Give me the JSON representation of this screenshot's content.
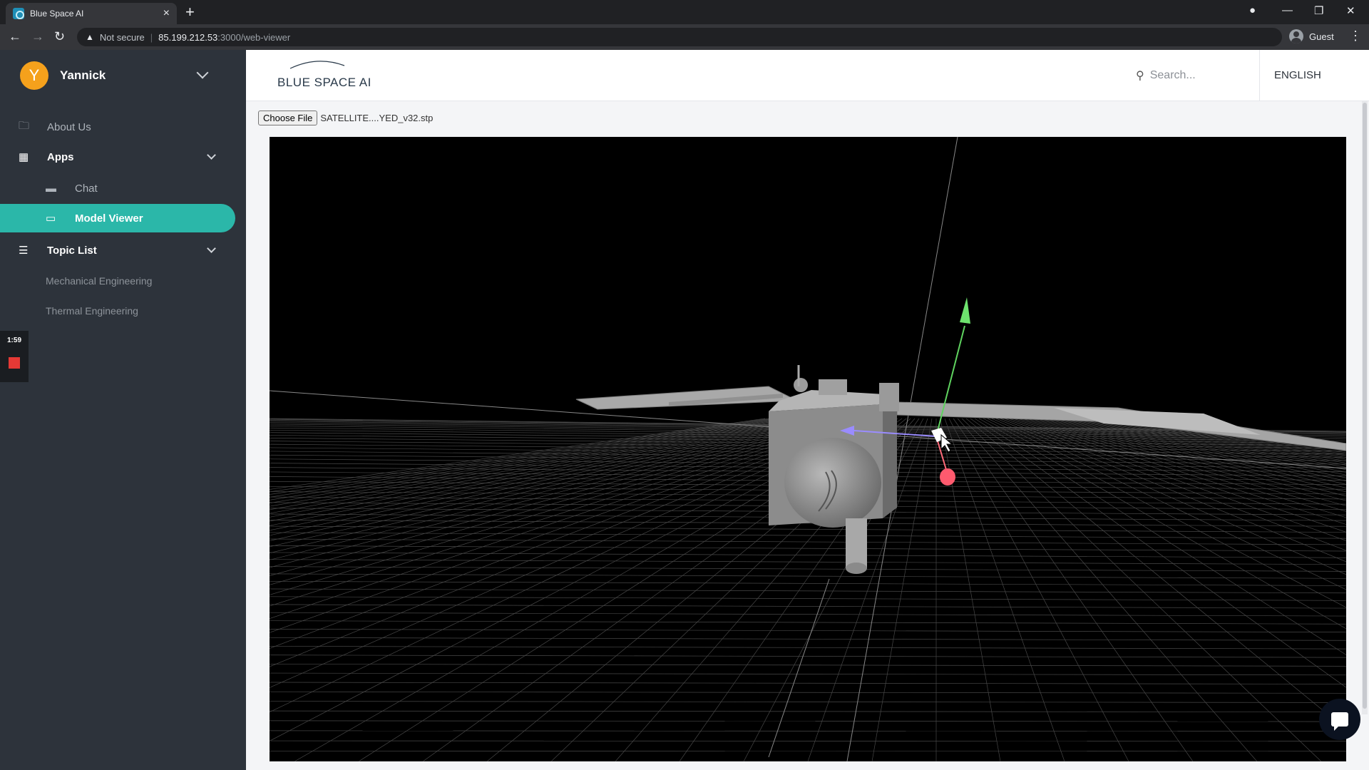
{
  "browser": {
    "tab_title": "Blue Space AI",
    "tab_close": "×",
    "new_tab": "+",
    "security_label": "Not secure",
    "url_host": "85.199.212.53",
    "url_path": ":3000/web-viewer",
    "profile_name": "Guest"
  },
  "sidebar": {
    "user_initial": "Y",
    "user_name": "Yannick",
    "items": [
      {
        "label": "About Us",
        "icon": "briefcase-icon"
      },
      {
        "label": "Apps",
        "icon": "grid-icon"
      },
      {
        "label": "Chat",
        "icon": "chat-icon"
      },
      {
        "label": "Model Viewer",
        "icon": "monitor-icon",
        "active": true
      },
      {
        "label": "Topic List",
        "icon": "list-icon"
      },
      {
        "label": "Mechanical Engineering"
      },
      {
        "label": "Thermal Engineering"
      }
    ],
    "recorder_time": "1:59"
  },
  "header": {
    "logo_text": "BLUE SPACE AI",
    "search_placeholder": "Search...",
    "language": "ENGLISH"
  },
  "viewer": {
    "choose_file_label": "Choose File",
    "file_name": "SATELLITE....YED_v32.stp"
  },
  "colors": {
    "sidebar_bg": "#2d333b",
    "accent": "#2bb7a9",
    "avatar": "#f5a11c",
    "record": "#e53935"
  }
}
